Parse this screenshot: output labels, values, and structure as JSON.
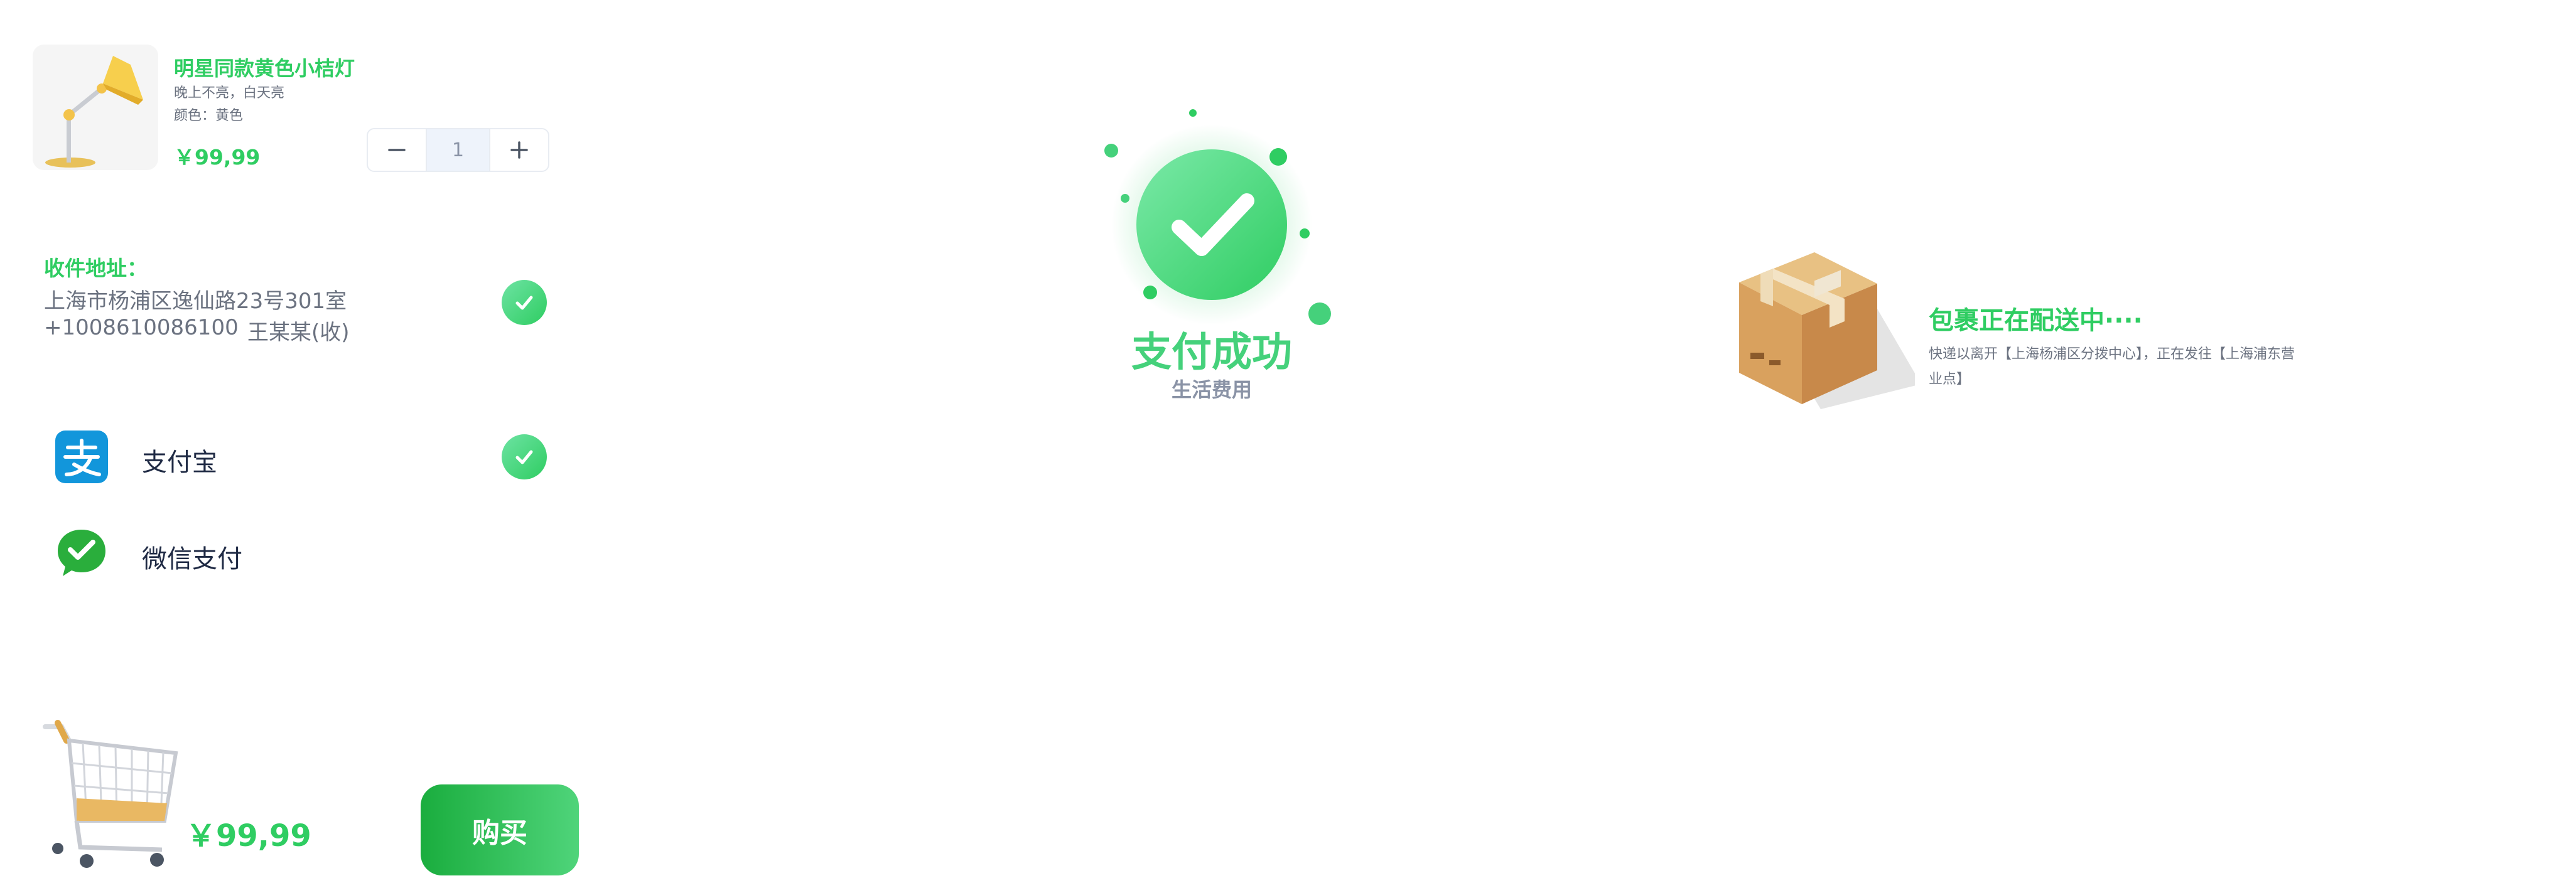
{
  "product": {
    "name": "明星同款黄色小桔灯",
    "description": "晚上不亮，白天亮",
    "color_text": "颜色：黄色",
    "price": "￥99,99",
    "quantity": "1",
    "image_icon": "desk-lamp-icon"
  },
  "address": {
    "label": "收件地址：",
    "line": "上海市杨浦区逸仙路23号301室",
    "phone": "+1008610086100",
    "recipient": "王某某(收)"
  },
  "payment": {
    "methods": [
      {
        "label": "支付宝",
        "icon": "alipay-icon",
        "selected": true
      },
      {
        "label": "微信支付",
        "icon": "wechat-pay-icon",
        "selected": false
      }
    ]
  },
  "checkout": {
    "total": "￥99,99",
    "buy_label": "购买",
    "cart_icon": "shopping-cart-icon"
  },
  "success": {
    "title": "支付成功",
    "subtitle": "生活费用"
  },
  "shipping": {
    "title": "包裹正在配送中····",
    "detail": "快递以离开【上海杨浦区分拨中心】，正在发往【上海浦东营业点】",
    "icon": "package-box-icon"
  },
  "colors": {
    "accent": "#2fcd62",
    "accent_light": "#6de3a3",
    "text_muted": "#6b7280",
    "text_dark": "#1f2a44",
    "alipay": "#1296db",
    "wechat": "#2aae3c"
  }
}
